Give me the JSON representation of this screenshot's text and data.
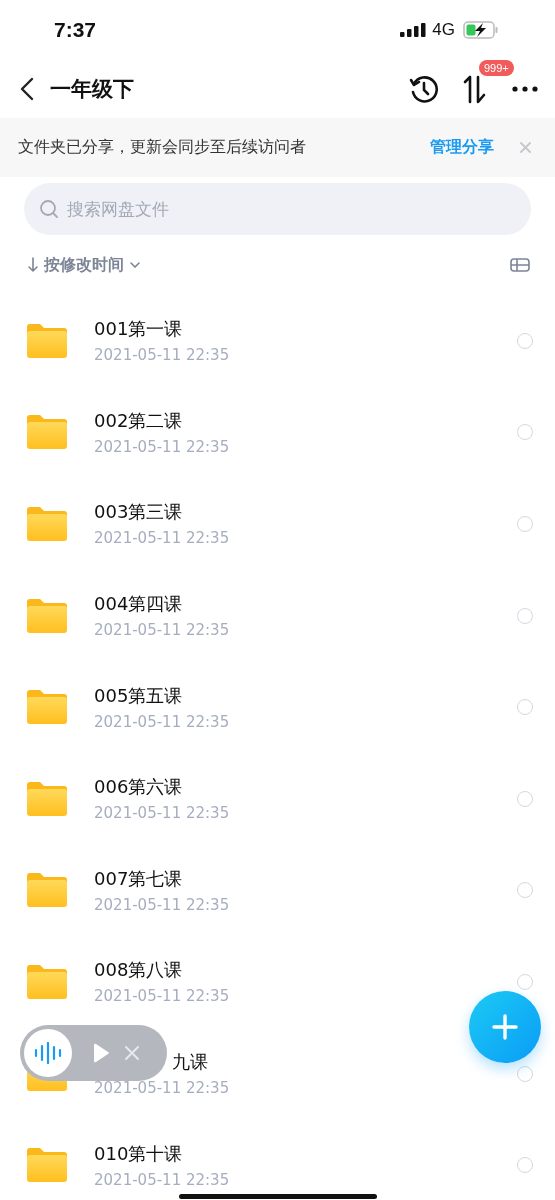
{
  "status_bar": {
    "time": "7:37",
    "network": "4G"
  },
  "nav": {
    "title": "一年级下",
    "badge": "999+"
  },
  "share_banner": {
    "message": "文件夹已分享，更新会同步至后续访问者",
    "action": "管理分享"
  },
  "search": {
    "placeholder": "搜索网盘文件"
  },
  "sort": {
    "label": "按修改时间"
  },
  "files": [
    {
      "name": "001第一课",
      "date": "2021-05-11 22:35",
      "selected": false
    },
    {
      "name": "002第二课",
      "date": "2021-05-11 22:35",
      "selected": false
    },
    {
      "name": "003第三课",
      "date": "2021-05-11 22:35",
      "selected": false
    },
    {
      "name": "004第四课",
      "date": "2021-05-11 22:35",
      "selected": false
    },
    {
      "name": "005第五课",
      "date": "2021-05-11 22:35",
      "selected": false
    },
    {
      "name": "006第六课",
      "date": "2021-05-11 22:35",
      "selected": false
    },
    {
      "name": "007第七课",
      "date": "2021-05-11 22:35",
      "selected": false
    },
    {
      "name": "008第八课",
      "date": "2021-05-11 22:35",
      "selected": false
    },
    {
      "name": "九课",
      "date": "2021-05-11 22:35",
      "selected": false,
      "covered": true
    },
    {
      "name": "010第十课",
      "date": "2021-05-11 22:35",
      "selected": false
    }
  ]
}
